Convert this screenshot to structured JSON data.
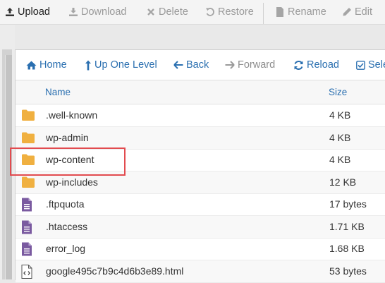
{
  "toolbar": {
    "upload": "Upload",
    "download": "Download",
    "delete": "Delete",
    "restore": "Restore",
    "rename": "Rename",
    "edit": "Edit"
  },
  "nav": {
    "home": "Home",
    "up_one_level": "Up One Level",
    "back": "Back",
    "forward": "Forward",
    "reload": "Reload",
    "select_all": "Sele"
  },
  "table": {
    "headers": {
      "name": "Name",
      "size": "Size"
    },
    "rows": [
      {
        "name": ".well-known",
        "size": "4 KB",
        "icon": "folder-icon"
      },
      {
        "name": "wp-admin",
        "size": "4 KB",
        "icon": "folder-icon"
      },
      {
        "name": "wp-content",
        "size": "4 KB",
        "icon": "folder-icon"
      },
      {
        "name": "wp-includes",
        "size": "12 KB",
        "icon": "folder-icon"
      },
      {
        "name": ".ftpquota",
        "size": "17 bytes",
        "icon": "text-file-icon"
      },
      {
        "name": ".htaccess",
        "size": "1.71 KB",
        "icon": "text-file-icon"
      },
      {
        "name": "error_log",
        "size": "1.68 KB",
        "icon": "text-file-icon"
      },
      {
        "name": "google495c7b9c4d6b3e89.html",
        "size": "53 bytes",
        "icon": "html-file-icon"
      }
    ]
  },
  "colors": {
    "link_blue": "#2a6fb0",
    "folder": "#f0b040",
    "file": "#7a5aa0",
    "highlight": "#e24b4f"
  }
}
